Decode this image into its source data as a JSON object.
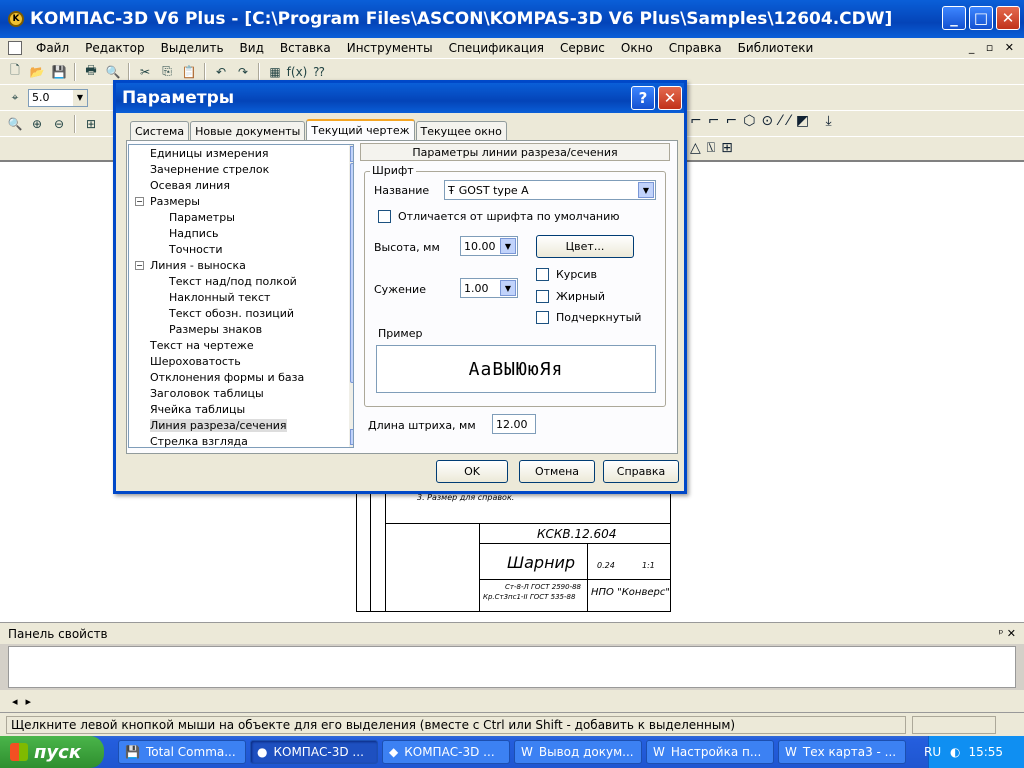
{
  "app": {
    "title": "КОМПАС-3D V6 Plus - [C:\\Program Files\\ASCON\\KOMPAS-3D V6 Plus\\Samples\\12604.CDW]",
    "icon_text": "K"
  },
  "menu": [
    "Файл",
    "Редактор",
    "Выделить",
    "Вид",
    "Вставка",
    "Инструменты",
    "Спецификация",
    "Сервис",
    "Окно",
    "Справка",
    "Библиотеки"
  ],
  "toolbar": {
    "scale_value": "5.0"
  },
  "dialog": {
    "title": "Параметры",
    "help_glyph": "?",
    "close_glyph": "✕",
    "tabs": [
      "Система",
      "Новые документы",
      "Текущий чертеж",
      "Текущее окно"
    ],
    "active_tab": 2,
    "tree": [
      {
        "label": "Единицы измерения",
        "level": 1,
        "expander": ""
      },
      {
        "label": "Зачернение стрелок",
        "level": 1,
        "expander": ""
      },
      {
        "label": "Осевая линия",
        "level": 1,
        "expander": ""
      },
      {
        "label": "Размеры",
        "level": 0,
        "expander": "−"
      },
      {
        "label": "Параметры",
        "level": 2,
        "expander": ""
      },
      {
        "label": "Надпись",
        "level": 2,
        "expander": ""
      },
      {
        "label": "Точности",
        "level": 2,
        "expander": ""
      },
      {
        "label": "Линия - выноска",
        "level": 0,
        "expander": "−"
      },
      {
        "label": "Текст над/под полкой",
        "level": 2,
        "expander": ""
      },
      {
        "label": "Наклонный текст",
        "level": 2,
        "expander": ""
      },
      {
        "label": "Текст обозн. позиций",
        "level": 2,
        "expander": ""
      },
      {
        "label": "Размеры знаков",
        "level": 2,
        "expander": ""
      },
      {
        "label": "Текст на чертеже",
        "level": 1,
        "expander": ""
      },
      {
        "label": "Шероховатость",
        "level": 1,
        "expander": ""
      },
      {
        "label": "Отклонения формы и база",
        "level": 1,
        "expander": ""
      },
      {
        "label": "Заголовок таблицы",
        "level": 1,
        "expander": ""
      },
      {
        "label": "Ячейка таблицы",
        "level": 1,
        "expander": ""
      },
      {
        "label": "Линия разреза/сечения",
        "level": 1,
        "expander": "",
        "selected": true
      },
      {
        "label": "Стрелка взгляда",
        "level": 1,
        "expander": ""
      }
    ],
    "panel_header": "Параметры линии разреза/сечения",
    "font_group_label": "Шрифт",
    "name_label": "Название",
    "font_name": "GOST type A",
    "font_icon": "Ŧ",
    "differs_label": "Отличается от шрифта по умолчанию",
    "height_label": "Высота, мм",
    "height_value": "10.00",
    "color_button": "Цвет...",
    "narrow_label": "Сужение",
    "narrow_value": "1.00",
    "italic_label": "Курсив",
    "bold_label": "Жирный",
    "underline_label": "Подчеркнутый",
    "sample_label": "Пример",
    "sample_text": "АаВЫЮюЯя",
    "stroke_label": "Длина штриха, мм",
    "stroke_value": "12.00",
    "ok": "OK",
    "cancel": "Отмена",
    "help": "Справка"
  },
  "drawing": {
    "code": "КСКВ.12.604",
    "name": "Шарнир",
    "company": "НПО \"Конверс\"",
    "material1": "Ст-8-Л ГОСТ 2590-88",
    "material2": "Кр.Ст3пс1-II ГОСТ 535-88",
    "mass": "0.24",
    "scale": "1:1",
    "note": "3. Размер для справок."
  },
  "propbar": {
    "title": "Панель свойств",
    "pin": "ᵖ ✕"
  },
  "nav": {
    "left": "◂",
    "right": "▸"
  },
  "status": {
    "text": "Щелкните левой кнопкой мыши на объекте для его выделения (вместе с Ctrl или Shift - добавить к выделенным)"
  },
  "taskbar": {
    "start": "пуск",
    "tasks": [
      {
        "label": "Total Comma...",
        "icon": "💾"
      },
      {
        "label": "КОМПАС-3D ...",
        "icon": "●",
        "active": true
      },
      {
        "label": "КОМПАС-3D ...",
        "icon": "◆"
      },
      {
        "label": "Вывод докум...",
        "icon": "W"
      },
      {
        "label": "Настройка п...",
        "icon": "W"
      },
      {
        "label": "Тех карта3 - ...",
        "icon": "W"
      }
    ],
    "lang": "RU",
    "time": "15:55"
  }
}
